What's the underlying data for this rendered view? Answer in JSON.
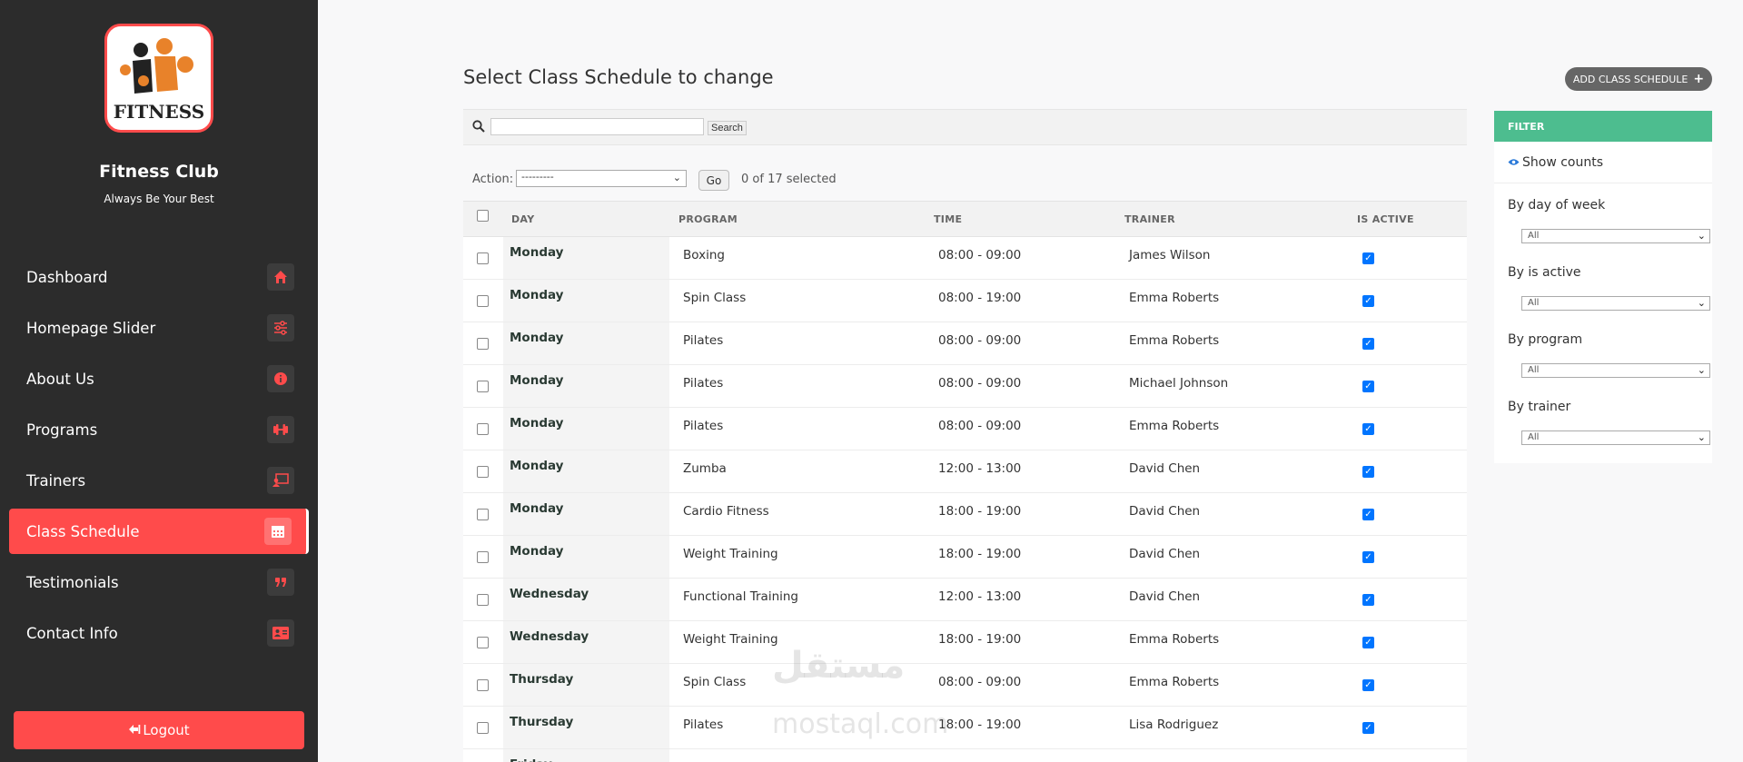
{
  "sidebar": {
    "logo_text": "FITNESS",
    "brand_name": "Fitness Club",
    "tagline": "Always Be Your Best",
    "items": [
      {
        "label": "Dashboard",
        "icon": "home-icon"
      },
      {
        "label": "Homepage Slider",
        "icon": "sliders-icon"
      },
      {
        "label": "About Us",
        "icon": "info-icon"
      },
      {
        "label": "Programs",
        "icon": "dumbbell-icon"
      },
      {
        "label": "Trainers",
        "icon": "chalkboard-teacher-icon"
      },
      {
        "label": "Class Schedule",
        "icon": "calendar-icon",
        "active": true
      },
      {
        "label": "Testimonials",
        "icon": "quote-icon"
      },
      {
        "label": "Contact Info",
        "icon": "address-card-icon"
      }
    ],
    "logout_label": "Logout"
  },
  "main": {
    "title": "Select Class Schedule to change",
    "add_button_label": "ADD CLASS SCHEDULE",
    "search": {
      "placeholder": "",
      "button_label": "Search"
    },
    "action": {
      "label": "Action:",
      "selected": "---------",
      "go_label": "Go",
      "selected_count": "0 of 17 selected"
    },
    "table": {
      "columns": [
        "DAY",
        "PROGRAM",
        "TIME",
        "TRAINER",
        "IS ACTIVE"
      ],
      "rows": [
        {
          "day": "Monday",
          "program": "Boxing",
          "time": "08:00 - 09:00",
          "trainer": "James Wilson",
          "active": true
        },
        {
          "day": "Monday",
          "program": "Spin Class",
          "time": "08:00 - 19:00",
          "trainer": "Emma Roberts",
          "active": true
        },
        {
          "day": "Monday",
          "program": "Pilates",
          "time": "08:00 - 09:00",
          "trainer": "Emma Roberts",
          "active": true
        },
        {
          "day": "Monday",
          "program": "Pilates",
          "time": "08:00 - 09:00",
          "trainer": "Michael Johnson",
          "active": true
        },
        {
          "day": "Monday",
          "program": "Pilates",
          "time": "08:00 - 09:00",
          "trainer": "Emma Roberts",
          "active": true
        },
        {
          "day": "Monday",
          "program": "Zumba",
          "time": "12:00 - 13:00",
          "trainer": "David Chen",
          "active": true
        },
        {
          "day": "Monday",
          "program": "Cardio Fitness",
          "time": "18:00 - 19:00",
          "trainer": "David Chen",
          "active": true
        },
        {
          "day": "Monday",
          "program": "Weight Training",
          "time": "18:00 - 19:00",
          "trainer": "David Chen",
          "active": true
        },
        {
          "day": "Wednesday",
          "program": "Functional Training",
          "time": "12:00 - 13:00",
          "trainer": "David Chen",
          "active": true
        },
        {
          "day": "Wednesday",
          "program": "Weight Training",
          "time": "18:00 - 19:00",
          "trainer": "Emma Roberts",
          "active": true
        },
        {
          "day": "Thursday",
          "program": "Spin Class",
          "time": "08:00 - 09:00",
          "trainer": "Emma Roberts",
          "active": true
        },
        {
          "day": "Thursday",
          "program": "Pilates",
          "time": "18:00 - 19:00",
          "trainer": "Lisa Rodriguez",
          "active": true
        },
        {
          "day": "Friday",
          "program": "",
          "time": "",
          "trainer": "",
          "active": false
        }
      ]
    }
  },
  "filter": {
    "title": "FILTER",
    "show_counts": "Show counts",
    "groups": [
      {
        "label": "By day of week",
        "selected": "All"
      },
      {
        "label": "By is active",
        "selected": "All"
      },
      {
        "label": "By program",
        "selected": "All"
      },
      {
        "label": "By trainer",
        "selected": "All"
      }
    ]
  },
  "watermark": {
    "arabic": "مستقل",
    "latin": "mostaql.com"
  },
  "colors": {
    "accent": "#ff4b4b",
    "sidebar_bg": "#2c2c2c",
    "filter_header": "#4dbd8f",
    "checkbox_blue": "#0075ff"
  }
}
